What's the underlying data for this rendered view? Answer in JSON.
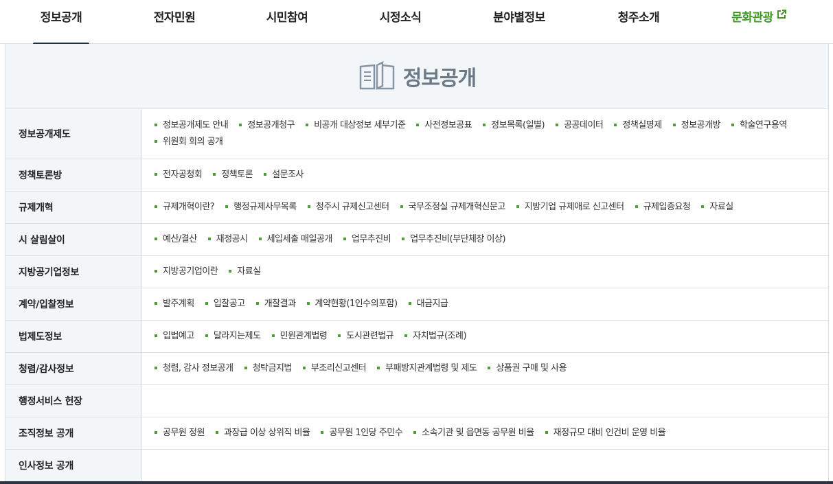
{
  "nav": {
    "items": [
      {
        "label": "정보공개",
        "active": true
      },
      {
        "label": "전자민원"
      },
      {
        "label": "시민참여"
      },
      {
        "label": "시정소식"
      },
      {
        "label": "분야별정보"
      },
      {
        "label": "청주소개"
      },
      {
        "label": "문화관광",
        "external": true
      }
    ],
    "accent_color": "#18323f",
    "external_color": "#3f9a1f"
  },
  "panel": {
    "title": "정보공개",
    "title_icon": "open-book-icon",
    "rows": [
      {
        "label": "정보공개제도",
        "links": [
          "정보공개제도 안내",
          "정보공개청구",
          "비공개 대상정보 세부기준",
          "사전정보공표",
          "정보목록(일별)",
          "공공데이터",
          "정책실명제",
          "정보공개방",
          "학술연구용역",
          "위원회 회의 공개"
        ]
      },
      {
        "label": "정책토론방",
        "links": [
          "전자공청회",
          "정책토론",
          "설문조사"
        ]
      },
      {
        "label": "규제개혁",
        "links": [
          "규제개혁이란?",
          "행정규제사무목록",
          "청주시 규제신고센터",
          "국무조정실 규제개혁신문고",
          "지방기업 규제애로 신고센터",
          "규제입증요청",
          "자료실"
        ]
      },
      {
        "label": "시 살림살이",
        "links": [
          "예산/결산",
          "재정공시",
          "세입세출 매일공개",
          "업무추진비",
          "업무추진비(부단체장 이상)"
        ]
      },
      {
        "label": "지방공기업정보",
        "links": [
          "지방공기업이란",
          "자료실"
        ]
      },
      {
        "label": "계약/입찰정보",
        "links": [
          "발주계획",
          "입찰공고",
          "개찰결과",
          "계약현황(1인수의포함)",
          "대금지급"
        ]
      },
      {
        "label": "법제도정보",
        "links": [
          "입법예고",
          "달라지는제도",
          "민원관계법령",
          "도시관련법규",
          "자치법규(조례)"
        ]
      },
      {
        "label": "청렴/감사정보",
        "links": [
          "청렴, 감사 정보공개",
          "청탁금지법",
          "부조리신고센터",
          "부패방지관계법령 및 제도",
          "상품권 구매 및 사용"
        ]
      },
      {
        "label": "행정서비스 헌장",
        "links": []
      },
      {
        "label": "조직정보 공개",
        "links": [
          "공무원 정원",
          "과장급 이상 상위직 비율",
          "공무원 1인당 주민수",
          "소속기관 및 읍면동 공무원 비율",
          "재정규모 대비 인건비 운영 비율"
        ]
      },
      {
        "label": "인사정보 공개",
        "links": []
      }
    ],
    "bullet_color": "#4aa035"
  }
}
